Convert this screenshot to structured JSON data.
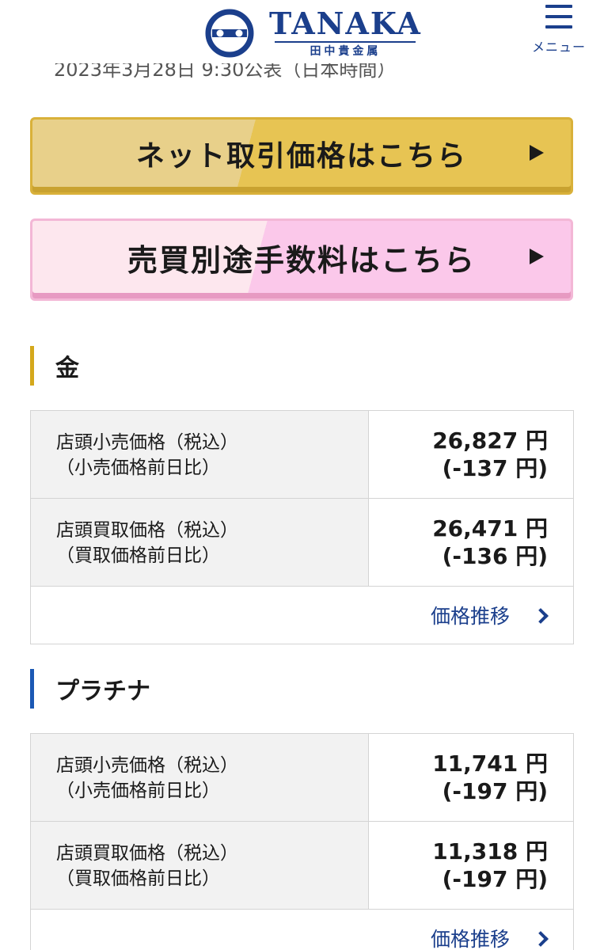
{
  "header": {
    "logo_main": "TANAKA",
    "logo_sub": "田中貴金属",
    "menu_label": "メニュー"
  },
  "date_line": "2023年3月28日 9:30公表（日本時間）",
  "buttons": {
    "net_price": "ネット取引価格はこちら",
    "fees": "売買別途手数料はこちら"
  },
  "gold": {
    "title": "金",
    "retail_label_1": "店頭小売価格（税込）",
    "retail_label_2": "（小売価格前日比）",
    "retail_price": "26,827 円",
    "retail_change": "(-137 円)",
    "buy_label_1": "店頭買取価格（税込）",
    "buy_label_2": "（買取価格前日比）",
    "buy_price": "26,471 円",
    "buy_change": "(-136 円)",
    "trend_link": "価格推移"
  },
  "platinum": {
    "title": "プラチナ",
    "retail_label_1": "店頭小売価格（税込）",
    "retail_label_2": "（小売価格前日比）",
    "retail_price": "11,741 円",
    "retail_change": "(-197 円)",
    "buy_label_1": "店頭買取価格（税込）",
    "buy_label_2": "（買取価格前日比）",
    "buy_price": "11,318 円",
    "buy_change": "(-197 円)",
    "trend_link": "価格推移"
  },
  "icons": {
    "logo": "tanaka-logo-icon",
    "menu": "hamburger-menu-icon",
    "arrow": "play-arrow-icon",
    "chevron": "chevron-right-icon"
  },
  "colors": {
    "brand_navy": "#1b3f8c",
    "gold_accent": "#d4a81c",
    "platinum_accent": "#1b58b4",
    "gold_button": "#e7c453",
    "pink_button": "#fbc8ea"
  }
}
